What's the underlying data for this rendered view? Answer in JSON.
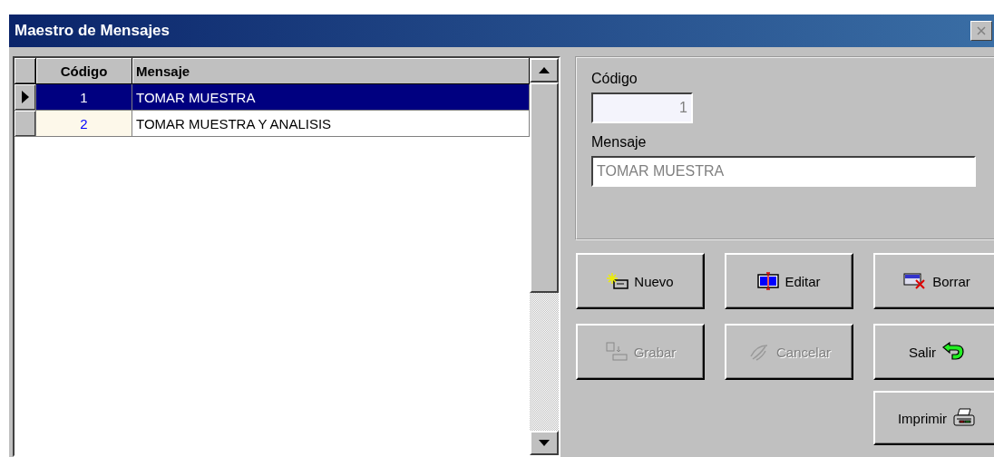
{
  "window": {
    "title": "Maestro de Mensajes"
  },
  "grid": {
    "columns": [
      "Código",
      "Mensaje"
    ],
    "rows": [
      {
        "codigo": "1",
        "mensaje": "TOMAR MUESTRA",
        "selected": true
      },
      {
        "codigo": "2",
        "mensaje": "TOMAR MUESTRA Y ANALISIS",
        "selected": false
      }
    ]
  },
  "detail": {
    "fields": [
      {
        "label": "Código",
        "value": "1",
        "kind": "code"
      },
      {
        "label": "Mensaje",
        "value": "TOMAR MUESTRA",
        "kind": "text"
      }
    ]
  },
  "buttons": [
    {
      "label": "Nuevo",
      "kind": "new",
      "disabled": false
    },
    {
      "label": "Editar",
      "kind": "edit",
      "disabled": false
    },
    {
      "label": "Borrar",
      "kind": "delete",
      "disabled": false
    },
    {
      "label": "Grabar",
      "kind": "save",
      "disabled": true
    },
    {
      "label": "Cancelar",
      "kind": "cancel",
      "disabled": true
    },
    {
      "label": "Salir",
      "kind": "exit",
      "disabled": false
    },
    {
      "label": "Imprimir",
      "kind": "print",
      "disabled": false
    }
  ]
}
